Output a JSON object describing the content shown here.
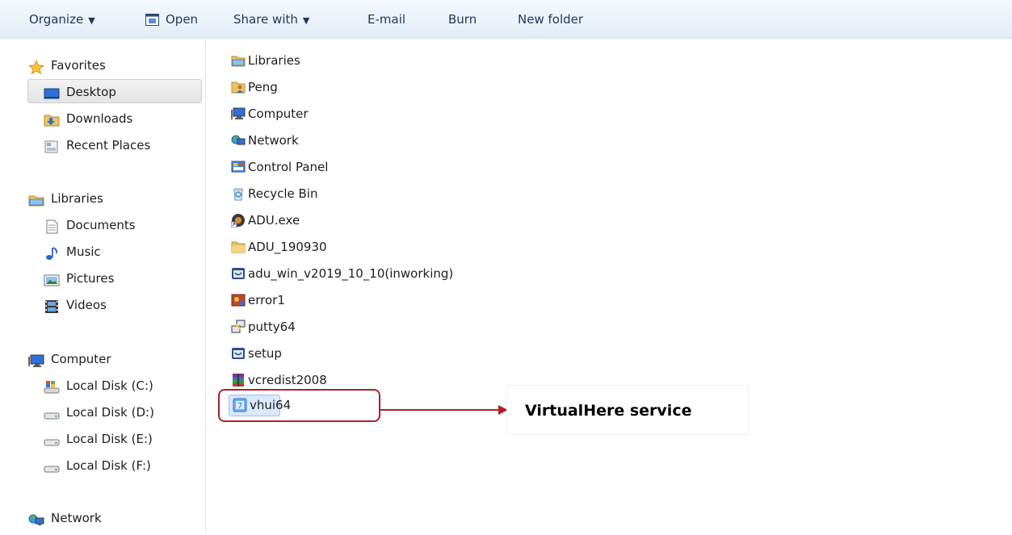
{
  "toolbar": {
    "organize": "Organize",
    "open": "Open",
    "share_with": "Share with",
    "email": "E-mail",
    "burn": "Burn",
    "new_folder": "New folder"
  },
  "nav": {
    "favorites": {
      "label": "Favorites",
      "items": [
        "Desktop",
        "Downloads",
        "Recent Places"
      ]
    },
    "libraries": {
      "label": "Libraries",
      "items": [
        "Documents",
        "Music",
        "Pictures",
        "Videos"
      ]
    },
    "computer": {
      "label": "Computer",
      "items": [
        "Local Disk (C:)",
        "Local Disk (D:)",
        "Local Disk (E:)",
        "Local Disk (F:)"
      ]
    },
    "network": {
      "label": "Network"
    },
    "selected": "Desktop"
  },
  "files": [
    {
      "name": "Libraries",
      "icon": "libraries-icon"
    },
    {
      "name": "Peng",
      "icon": "user-folder-icon"
    },
    {
      "name": "Computer",
      "icon": "computer-icon"
    },
    {
      "name": "Network",
      "icon": "network-icon"
    },
    {
      "name": "Control Panel",
      "icon": "control-panel-icon"
    },
    {
      "name": "Recycle Bin",
      "icon": "recycle-bin-icon"
    },
    {
      "name": "ADU.exe",
      "icon": "exe-shortcut-icon"
    },
    {
      "name": "ADU_190930",
      "icon": "folder-icon"
    },
    {
      "name": "adu_win_v2019_10_10(inworking)",
      "icon": "app-icon"
    },
    {
      "name": "error1",
      "icon": "image-file-icon"
    },
    {
      "name": "putty64",
      "icon": "putty-icon"
    },
    {
      "name": "setup",
      "icon": "app-icon"
    },
    {
      "name": "vcredist2008",
      "icon": "archive-icon"
    },
    {
      "name": "vhui64",
      "icon": "vhui-app-icon"
    }
  ],
  "selected_file": "vhui64",
  "annotation": {
    "label": "VirtualHere service",
    "color": "#b0202a"
  }
}
